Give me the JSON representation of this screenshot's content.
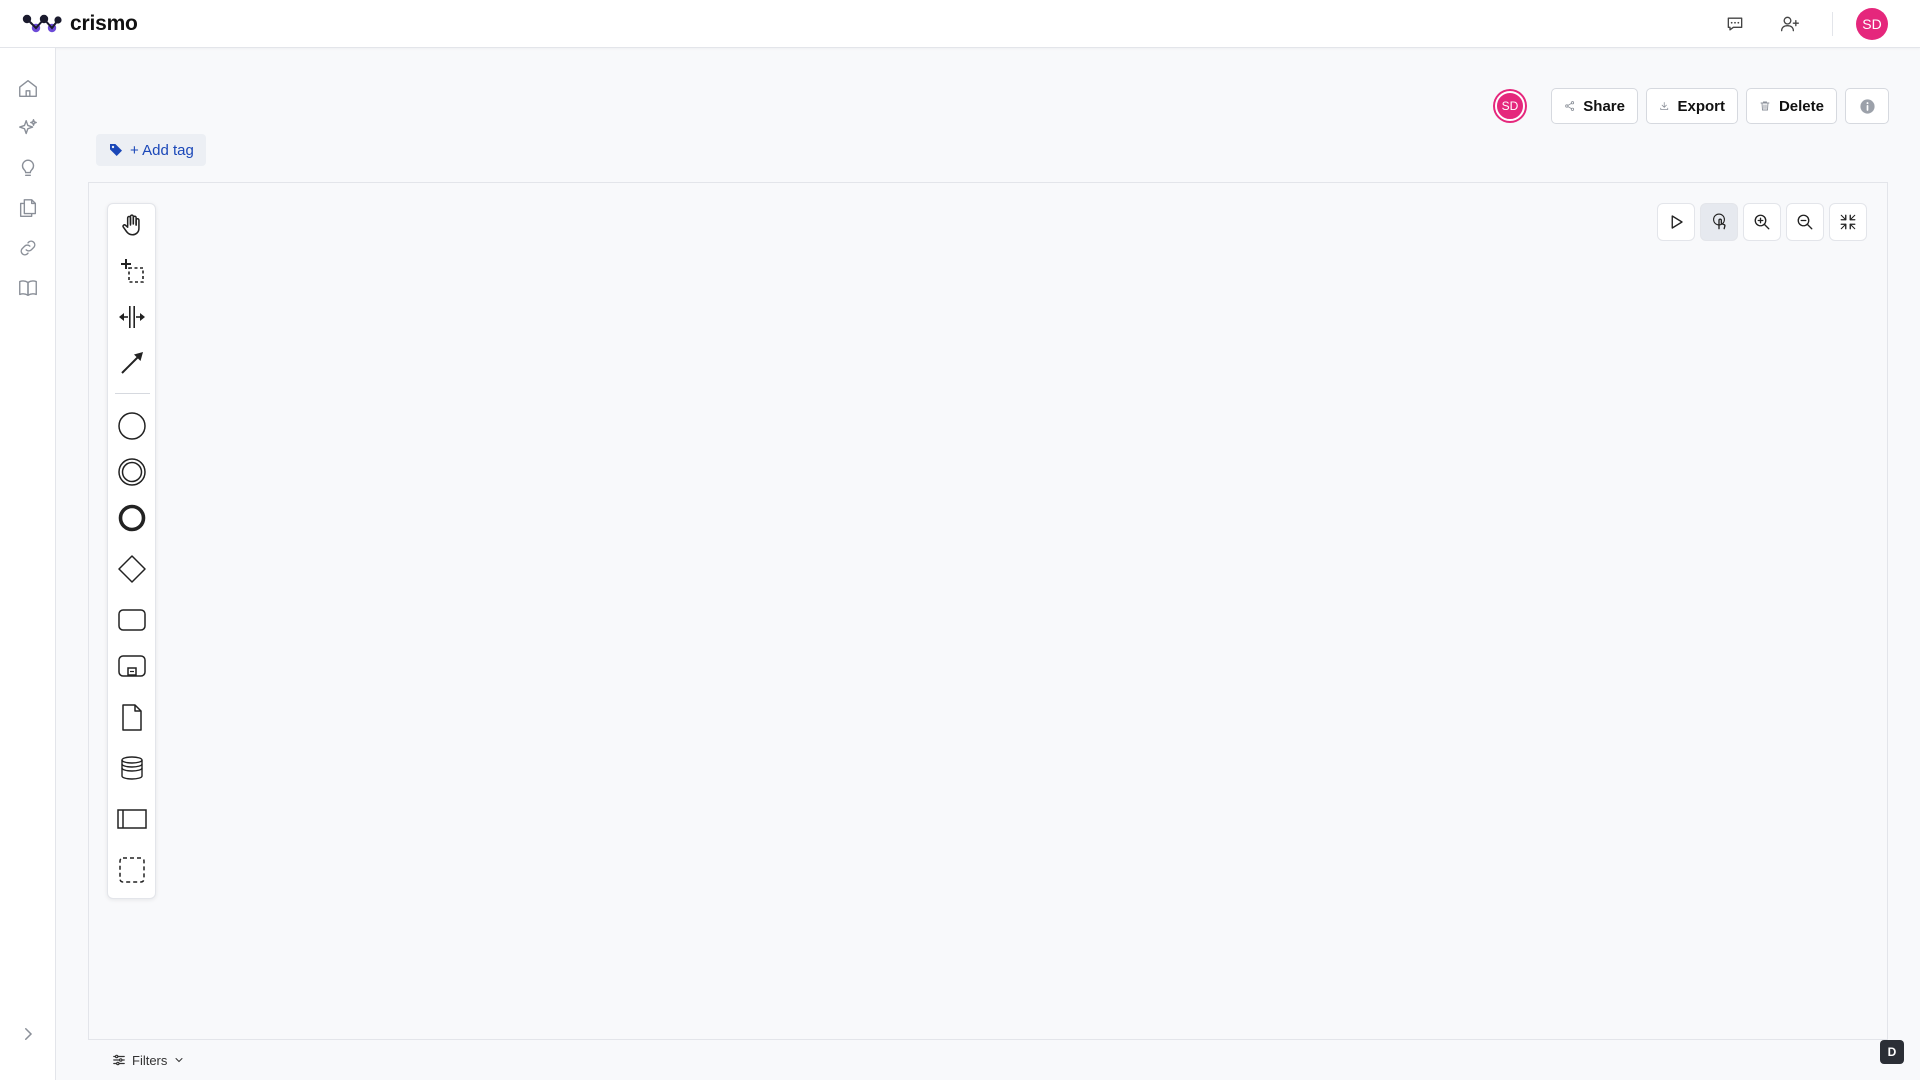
{
  "app": {
    "name": "crismo"
  },
  "user": {
    "initials": "SD"
  },
  "header": {
    "share_label": "Share",
    "export_label": "Export",
    "delete_label": "Delete",
    "add_tag_label": "+ Add tag"
  },
  "footer": {
    "filters_label": "Filters",
    "debug_badge": "D"
  },
  "icons": {
    "top": [
      "chat-icon",
      "add-user-icon"
    ],
    "rail": [
      "home-icon",
      "sparkles-icon",
      "lightbulb-icon",
      "documents-icon",
      "link-icon",
      "book-icon",
      "chevron-right-icon"
    ],
    "tools": [
      "hand-tool-icon",
      "lasso-tool-icon",
      "space-tool-icon",
      "connect-tool-icon",
      "start-event-icon",
      "intermediate-event-icon",
      "end-event-icon",
      "gateway-icon",
      "task-icon",
      "subprocess-icon",
      "data-object-icon",
      "data-store-icon",
      "pool-icon",
      "group-icon"
    ],
    "controls": [
      "play-icon",
      "touch-icon",
      "zoom-in-icon",
      "zoom-out-icon",
      "fit-icon"
    ]
  },
  "colors": {
    "accent": "#e5277c",
    "tag_text": "#1a47b8"
  }
}
